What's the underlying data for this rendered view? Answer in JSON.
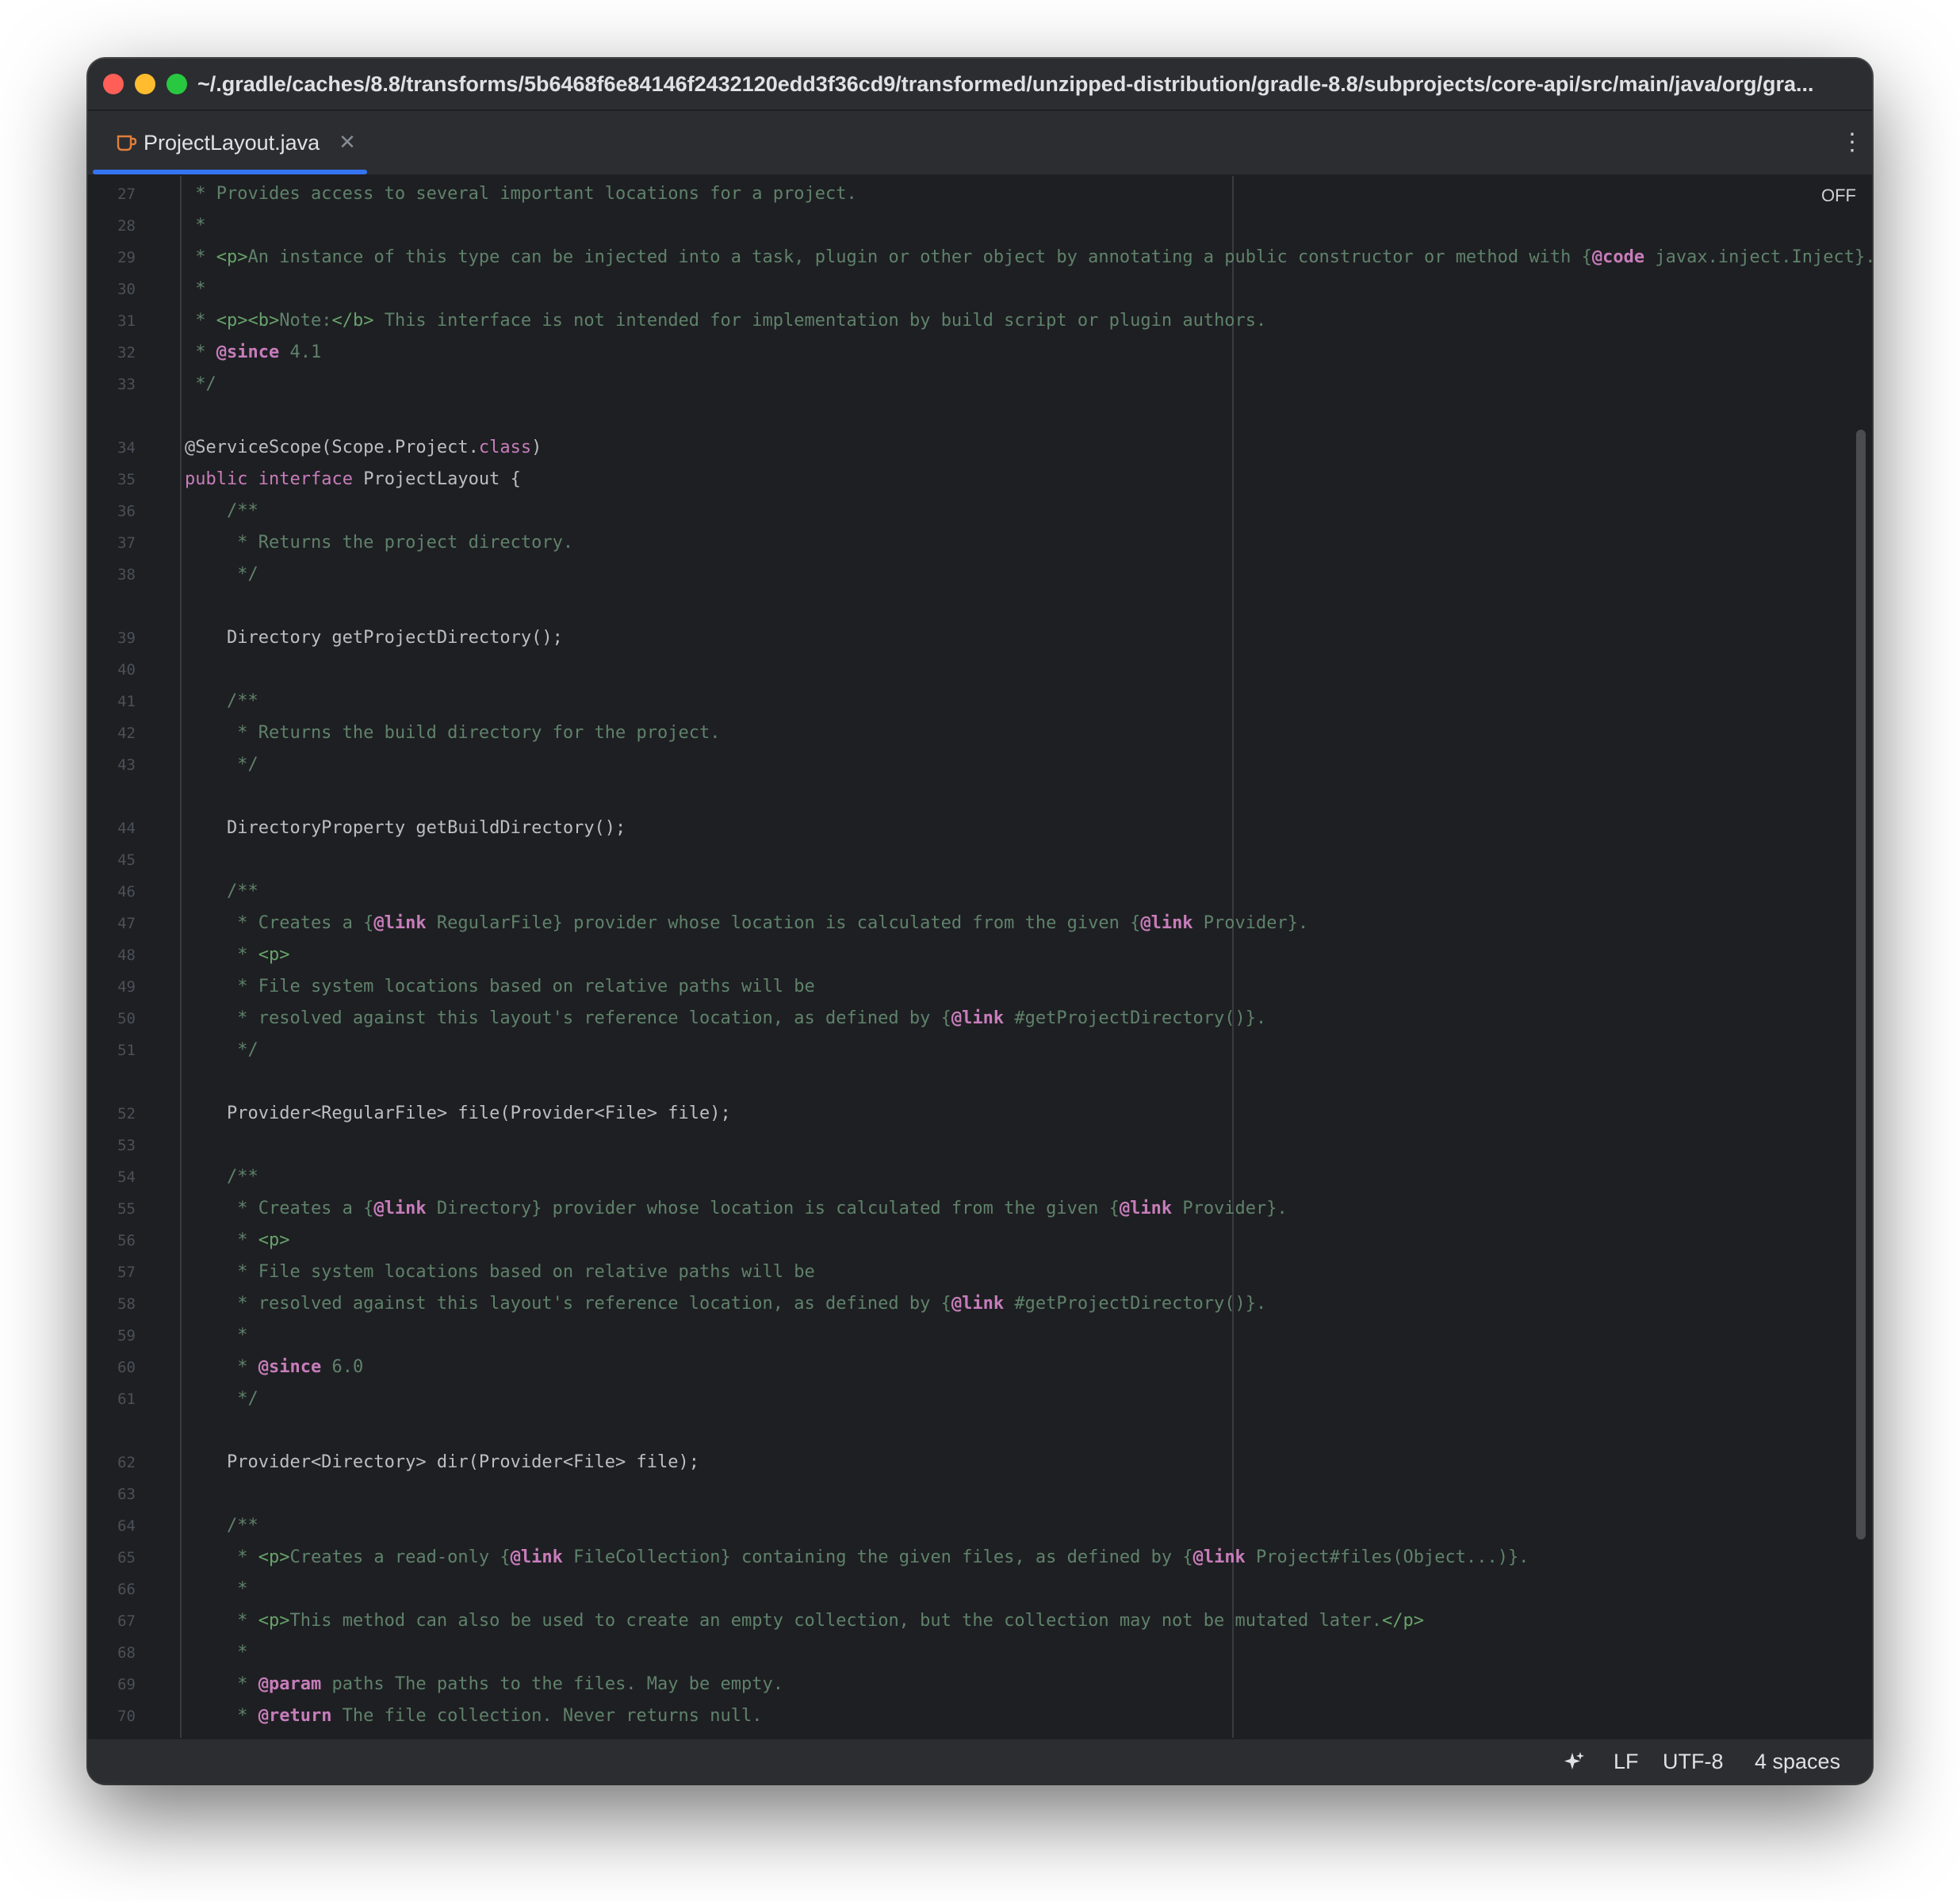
{
  "window": {
    "title_path": "~/.gradle/caches/8.8/transforms/5b6468f6e84146f2432120edd3f36cd9/transformed/unzipped-distribution/gradle-8.8/subprojects/core-api/src/main/java/org/gra..."
  },
  "tabs": [
    {
      "label": "ProjectLayout.java",
      "icon": "java-file-icon",
      "active": true
    }
  ],
  "editor": {
    "inspection_toggle": "OFF",
    "lines": [
      {
        "n": "27",
        "segs": [
          [
            "doc",
            " * Provides access to several important locations for a project."
          ]
        ]
      },
      {
        "n": "28",
        "segs": [
          [
            "doc",
            " *"
          ]
        ]
      },
      {
        "n": "29",
        "segs": [
          [
            "doc",
            " * "
          ],
          [
            "tag",
            "<p>"
          ],
          [
            "doc",
            "An instance of this type can be injected into a task, plugin or other object by annotating a public constructor or method with {"
          ],
          [
            "dtag",
            "@code"
          ],
          [
            "doc",
            " javax.inject.Inject}."
          ]
        ]
      },
      {
        "n": "30",
        "segs": [
          [
            "doc",
            " *"
          ]
        ]
      },
      {
        "n": "31",
        "segs": [
          [
            "doc",
            " * "
          ],
          [
            "tag",
            "<p><b>"
          ],
          [
            "doc",
            "Note:"
          ],
          [
            "tag",
            "</b>"
          ],
          [
            "doc",
            " This interface is not intended for implementation by build script or plugin authors."
          ]
        ]
      },
      {
        "n": "32",
        "segs": [
          [
            "doc",
            " * "
          ],
          [
            "dtag",
            "@since"
          ],
          [
            "doc",
            " 4.1"
          ]
        ]
      },
      {
        "n": "33",
        "segs": [
          [
            "doc",
            " */"
          ]
        ]
      },
      {
        "n": "",
        "segs": []
      },
      {
        "n": "34",
        "segs": [
          [
            "plain",
            "@ServiceScope(Scope.Project."
          ],
          [
            "kw2",
            "class"
          ],
          [
            "plain",
            ")"
          ]
        ]
      },
      {
        "n": "35",
        "segs": [
          [
            "kw2",
            "public"
          ],
          [
            "plain",
            " "
          ],
          [
            "kw2",
            "interface"
          ],
          [
            "plain",
            " ProjectLayout {"
          ]
        ]
      },
      {
        "n": "36",
        "segs": [
          [
            "doc",
            "    /**"
          ]
        ]
      },
      {
        "n": "37",
        "segs": [
          [
            "doc",
            "     * Returns the project directory."
          ]
        ]
      },
      {
        "n": "38",
        "segs": [
          [
            "doc",
            "     */"
          ]
        ]
      },
      {
        "n": "",
        "segs": []
      },
      {
        "n": "39",
        "segs": [
          [
            "plain",
            "    Directory getProjectDirectory();"
          ]
        ]
      },
      {
        "n": "40",
        "segs": []
      },
      {
        "n": "41",
        "segs": [
          [
            "doc",
            "    /**"
          ]
        ]
      },
      {
        "n": "42",
        "segs": [
          [
            "doc",
            "     * Returns the build directory for the project."
          ]
        ]
      },
      {
        "n": "43",
        "segs": [
          [
            "doc",
            "     */"
          ]
        ]
      },
      {
        "n": "",
        "segs": []
      },
      {
        "n": "44",
        "segs": [
          [
            "plain",
            "    DirectoryProperty getBuildDirectory();"
          ]
        ]
      },
      {
        "n": "45",
        "segs": []
      },
      {
        "n": "46",
        "segs": [
          [
            "doc",
            "    /**"
          ]
        ]
      },
      {
        "n": "47",
        "segs": [
          [
            "doc",
            "     * Creates a {"
          ],
          [
            "dtag",
            "@link"
          ],
          [
            "doc",
            " RegularFile} provider whose location is calculated from the given {"
          ],
          [
            "dtag",
            "@link"
          ],
          [
            "doc",
            " Provider}."
          ]
        ]
      },
      {
        "n": "48",
        "segs": [
          [
            "doc",
            "     * "
          ],
          [
            "tag",
            "<p>"
          ]
        ]
      },
      {
        "n": "49",
        "segs": [
          [
            "doc",
            "     * File system locations based on relative paths will be"
          ]
        ]
      },
      {
        "n": "50",
        "segs": [
          [
            "doc",
            "     * resolved against this layout's reference location, as defined by {"
          ],
          [
            "dtag",
            "@link"
          ],
          [
            "doc",
            " #getProjectDirectory()}."
          ]
        ]
      },
      {
        "n": "51",
        "segs": [
          [
            "doc",
            "     */"
          ]
        ]
      },
      {
        "n": "",
        "segs": []
      },
      {
        "n": "52",
        "segs": [
          [
            "plain",
            "    Provider<RegularFile> file(Provider<File> file);"
          ]
        ]
      },
      {
        "n": "53",
        "segs": []
      },
      {
        "n": "54",
        "segs": [
          [
            "doc",
            "    /**"
          ]
        ]
      },
      {
        "n": "55",
        "segs": [
          [
            "doc",
            "     * Creates a {"
          ],
          [
            "dtag",
            "@link"
          ],
          [
            "doc",
            " Directory} provider whose location is calculated from the given {"
          ],
          [
            "dtag",
            "@link"
          ],
          [
            "doc",
            " Provider}."
          ]
        ]
      },
      {
        "n": "56",
        "segs": [
          [
            "doc",
            "     * "
          ],
          [
            "tag",
            "<p>"
          ]
        ]
      },
      {
        "n": "57",
        "segs": [
          [
            "doc",
            "     * File system locations based on relative paths will be"
          ]
        ]
      },
      {
        "n": "58",
        "segs": [
          [
            "doc",
            "     * resolved against this layout's reference location, as defined by {"
          ],
          [
            "dtag",
            "@link"
          ],
          [
            "doc",
            " #getProjectDirectory()}."
          ]
        ]
      },
      {
        "n": "59",
        "segs": [
          [
            "doc",
            "     *"
          ]
        ]
      },
      {
        "n": "60",
        "segs": [
          [
            "doc",
            "     * "
          ],
          [
            "dtag",
            "@since"
          ],
          [
            "doc",
            " 6.0"
          ]
        ]
      },
      {
        "n": "61",
        "segs": [
          [
            "doc",
            "     */"
          ]
        ]
      },
      {
        "n": "",
        "segs": []
      },
      {
        "n": "62",
        "segs": [
          [
            "plain",
            "    Provider<Directory> dir(Provider<File> file);"
          ]
        ]
      },
      {
        "n": "63",
        "segs": []
      },
      {
        "n": "64",
        "segs": [
          [
            "doc",
            "    /**"
          ]
        ]
      },
      {
        "n": "65",
        "segs": [
          [
            "doc",
            "     * "
          ],
          [
            "tag",
            "<p>"
          ],
          [
            "doc",
            "Creates a read-only {"
          ],
          [
            "dtag",
            "@link"
          ],
          [
            "doc",
            " FileCollection} containing the given files, as defined by {"
          ],
          [
            "dtag",
            "@link"
          ],
          [
            "doc",
            " Project#files(Object...)}."
          ]
        ]
      },
      {
        "n": "66",
        "segs": [
          [
            "doc",
            "     *"
          ]
        ]
      },
      {
        "n": "67",
        "segs": [
          [
            "doc",
            "     * "
          ],
          [
            "tag",
            "<p>"
          ],
          [
            "doc",
            "This method can also be used to create an empty collection, but the collection may not be mutated later."
          ],
          [
            "tag",
            "</p>"
          ]
        ]
      },
      {
        "n": "68",
        "segs": [
          [
            "doc",
            "     *"
          ]
        ]
      },
      {
        "n": "69",
        "segs": [
          [
            "doc",
            "     * "
          ],
          [
            "dtag",
            "@param"
          ],
          [
            "doc",
            " paths The paths to the files. May be empty."
          ]
        ]
      },
      {
        "n": "70",
        "segs": [
          [
            "doc",
            "     * "
          ],
          [
            "dtag",
            "@return"
          ],
          [
            "doc",
            " The file collection. Never returns null."
          ]
        ]
      }
    ]
  },
  "statusbar": {
    "ai_icon": "ai-assistant-icon",
    "line_separator": "LF",
    "encoding": "UTF-8",
    "indent": "4 spaces"
  }
}
